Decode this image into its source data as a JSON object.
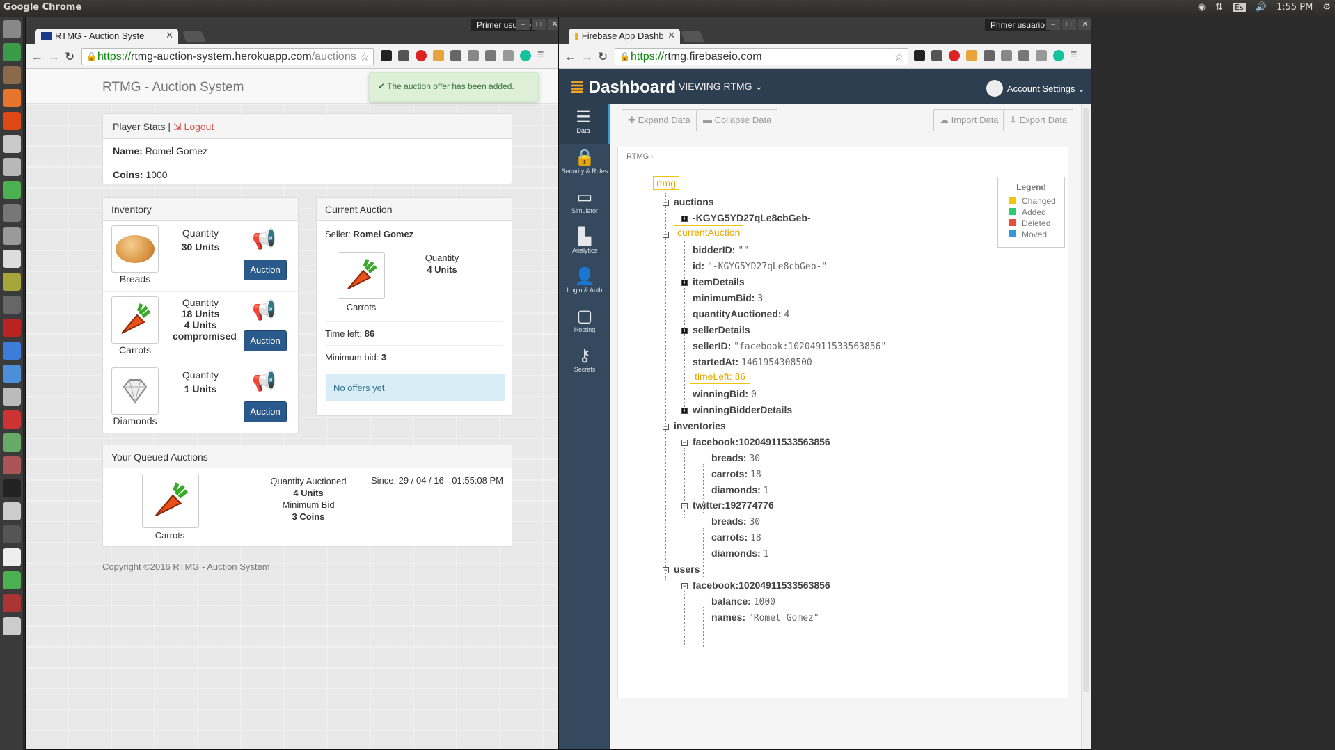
{
  "os": {
    "app_name": "Google Chrome",
    "time": "1:55 PM",
    "lang": "Es"
  },
  "left": {
    "tab_title": "RTMG - Auction Syste",
    "user": "Primer usuario",
    "url_scheme": "https://",
    "url_host": "rtmg-auction-system.herokuapp.com",
    "url_path": "/auctions",
    "brand": "RTMG - Auction System",
    "toast": "The auction offer has been added.",
    "stats": {
      "title": "Player Stats |",
      "logout": "Logout",
      "name_label": "Name:",
      "name": "Romel Gomez",
      "coins_label": "Coins:",
      "coins": "1000"
    },
    "inventory": {
      "title": "Inventory",
      "quantity_label": "Quantity",
      "auction_label": "Auction",
      "items": [
        {
          "name": "Breads",
          "units": "30 Units",
          "extra1": "",
          "extra2": ""
        },
        {
          "name": "Carrots",
          "units": "18 Units",
          "extra1": "4 Units",
          "extra2": "compromised"
        },
        {
          "name": "Diamonds",
          "units": "1 Units",
          "extra1": "",
          "extra2": ""
        }
      ]
    },
    "current": {
      "title": "Current Auction",
      "seller_label": "Seller:",
      "seller": "Romel Gomez",
      "quantity_label": "Quantity",
      "units": "4 Units",
      "item": "Carrots",
      "time_label": "Time left:",
      "time": "86",
      "min_label": "Minimum bid:",
      "min": "3",
      "offers": "No offers yet."
    },
    "queued": {
      "title": "Your Queued Auctions",
      "item": "Carrots",
      "qa_label": "Quantity Auctioned",
      "qa": "4 Units",
      "mb_label": "Minimum Bid",
      "mb": "3 Coins",
      "since": "Since: 29 / 04 / 16 - 01:55:08 PM"
    },
    "copyright": "Copyright ©2016 RTMG - Auction System"
  },
  "right": {
    "tab_title": "Firebase App Dashb",
    "user": "Primer usuario",
    "url_scheme": "https://",
    "url_host": "rtmg.firebaseio.com",
    "logo": "Dashboard",
    "viewing": "VIEWING RTMG",
    "account": "Account Settings",
    "sidebar": [
      {
        "label": "Data",
        "icon": "database-icon"
      },
      {
        "label": "Security & Rules",
        "icon": "lock-icon"
      },
      {
        "label": "Simulator",
        "icon": "monitor-icon"
      },
      {
        "label": "Analytics",
        "icon": "bar-chart-icon"
      },
      {
        "label": "Login & Auth",
        "icon": "user-icon"
      },
      {
        "label": "Hosting",
        "icon": "folder-icon"
      },
      {
        "label": "Secrets",
        "icon": "key-icon"
      }
    ],
    "buttons": {
      "expand": "Expand Data",
      "collapse": "Collapse Data",
      "import": "Import Data",
      "export": "Export Data"
    },
    "breadcrumb": "RTMG",
    "legend": {
      "title": "Legend",
      "items": [
        {
          "label": "Changed",
          "color": "#f1c40f"
        },
        {
          "label": "Added",
          "color": "#2ecc71"
        },
        {
          "label": "Deleted",
          "color": "#e74c3c"
        },
        {
          "label": "Moved",
          "color": "#3498db"
        }
      ]
    },
    "tree": {
      "root": "rtmg",
      "auctions": "auctions",
      "auction_id": "-KGYG5YD27qLe8cbGeb-",
      "currentAuction": "currentAuction",
      "bidderID_k": "bidderID:",
      "bidderID_v": "\"\"",
      "id_k": "id:",
      "id_v": "\"-KGYG5YD27qLe8cbGeb-\"",
      "itemDetails": "itemDetails",
      "minimumBid_k": "minimumBid:",
      "minimumBid_v": "3",
      "qty_k": "quantityAuctioned:",
      "qty_v": "4",
      "sellerDetails": "sellerDetails",
      "sellerID_k": "sellerID:",
      "sellerID_v": "\"facebook:10204911533563856\"",
      "startedAt_k": "startedAt:",
      "startedAt_v": "1461954308500",
      "timeLeft_k": "timeLeft:",
      "timeLeft_v": "86",
      "winningBid_k": "winningBid:",
      "winningBid_v": "0",
      "winningBidderDetails": "winningBidderDetails",
      "inventories": "inventories",
      "fb": "facebook:10204911533563856",
      "breads_k": "breads:",
      "breads_v": "30",
      "carrots_k": "carrots:",
      "carrots_v": "18",
      "diamonds_k": "diamonds:",
      "diamonds_v": "1",
      "tw": "twitter:192774776",
      "users": "users",
      "balance_k": "balance:",
      "balance_v": "1000",
      "names_k": "names:",
      "names_v": "\"Romel Gomez\""
    }
  }
}
